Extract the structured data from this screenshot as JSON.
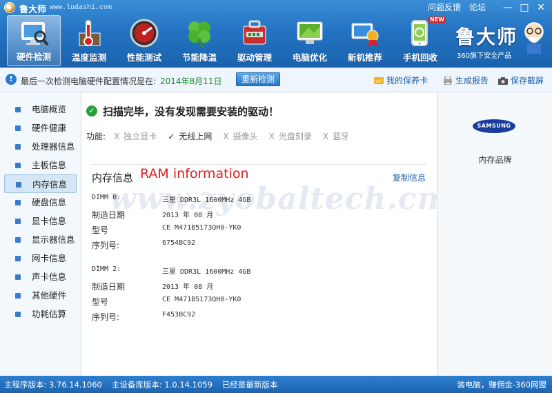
{
  "app": {
    "title": "鲁大师",
    "url": "www.ludashi.com",
    "feedback": "问题反馈",
    "forum": "论坛",
    "min": "—",
    "max": "□",
    "close": "✕"
  },
  "nav": [
    {
      "label": "硬件检测",
      "icon": "monitor-magnifier-icon",
      "active": true
    },
    {
      "label": "温度监测",
      "icon": "thermometer-icon"
    },
    {
      "label": "性能测试",
      "icon": "speedometer-icon"
    },
    {
      "label": "节能降温",
      "icon": "clover-icon"
    },
    {
      "label": "驱动管理",
      "icon": "driver-toolbox-icon"
    },
    {
      "label": "电脑优化",
      "icon": "screen-optimize-icon"
    },
    {
      "label": "新机推荐",
      "icon": "new-pc-award-icon"
    },
    {
      "label": "手机回收",
      "icon": "phone-recycle-icon",
      "badge": "NEW"
    }
  ],
  "brand": {
    "name": "鲁大师",
    "sub": "360旗下安全产品"
  },
  "infobar": {
    "text": "最后一次检测电脑硬件配置情况是在:",
    "date": "2014年8月11日",
    "recheck": "重新检测",
    "warranty": "我的保养卡",
    "report": "生成报告",
    "screenshot": "保存截屏"
  },
  "sidebar": [
    {
      "label": "电脑概览"
    },
    {
      "label": "硬件健康"
    },
    {
      "label": "处理器信息"
    },
    {
      "label": "主板信息"
    },
    {
      "label": "内存信息",
      "active": true
    },
    {
      "label": "硬盘信息"
    },
    {
      "label": "显卡信息"
    },
    {
      "label": "显示器信息"
    },
    {
      "label": "网卡信息"
    },
    {
      "label": "声卡信息"
    },
    {
      "label": "其他硬件"
    },
    {
      "label": "功耗估算"
    }
  ],
  "main": {
    "scan_msg": "扫描完毕，没有发现需要安装的驱动！",
    "features_label": "功能:",
    "features": [
      {
        "mark": "X",
        "label": "独立显卡",
        "on": false
      },
      {
        "mark": "✓",
        "label": "无线上网",
        "on": true
      },
      {
        "mark": "X",
        "label": "摄像头",
        "on": false
      },
      {
        "mark": "X",
        "label": "光盘刻录",
        "on": false
      },
      {
        "mark": "X",
        "label": "蓝牙",
        "on": false
      }
    ],
    "section_title": "内存信息",
    "ram_annotation": "RAM information",
    "copy": "复制信息",
    "watermark": "www.zyobaltech.cn",
    "dimms": [
      {
        "slot_key": "DIMM 0:",
        "slot_val": "三星 DDR3L 1600MHz 4GB",
        "date_key": "制造日期",
        "date_val": "2013 年 08 月",
        "model_key": "型号",
        "model_val": "CE M471B5173QH0-YK0",
        "serial_key": "序列号:",
        "serial_val": "6754BC92"
      },
      {
        "slot_key": "DIMM 2:",
        "slot_val": "三星 DDR3L 1600MHz 4GB",
        "date_key": "制造日期",
        "date_val": "2013 年 08 月",
        "model_key": "型号",
        "model_val": "CE M471B5173QH0-YK0",
        "serial_key": "序列号:",
        "serial_val": "F453BC92"
      }
    ]
  },
  "rightpanel": {
    "logo": "SAMSUNG",
    "label": "内存品牌"
  },
  "status": {
    "main_version": "主程序版本: 3.76.14.1060",
    "db_version": "主设备库版本: 1.0.14.1059",
    "latest": "已经是最新版本",
    "promo": "装电脑，赚佣金-360网盟"
  },
  "colors": {
    "header": "#2473c2",
    "accent_green": "#1a8a2a",
    "ram_red": "#e02020",
    "link_blue": "#1a5ea8"
  }
}
